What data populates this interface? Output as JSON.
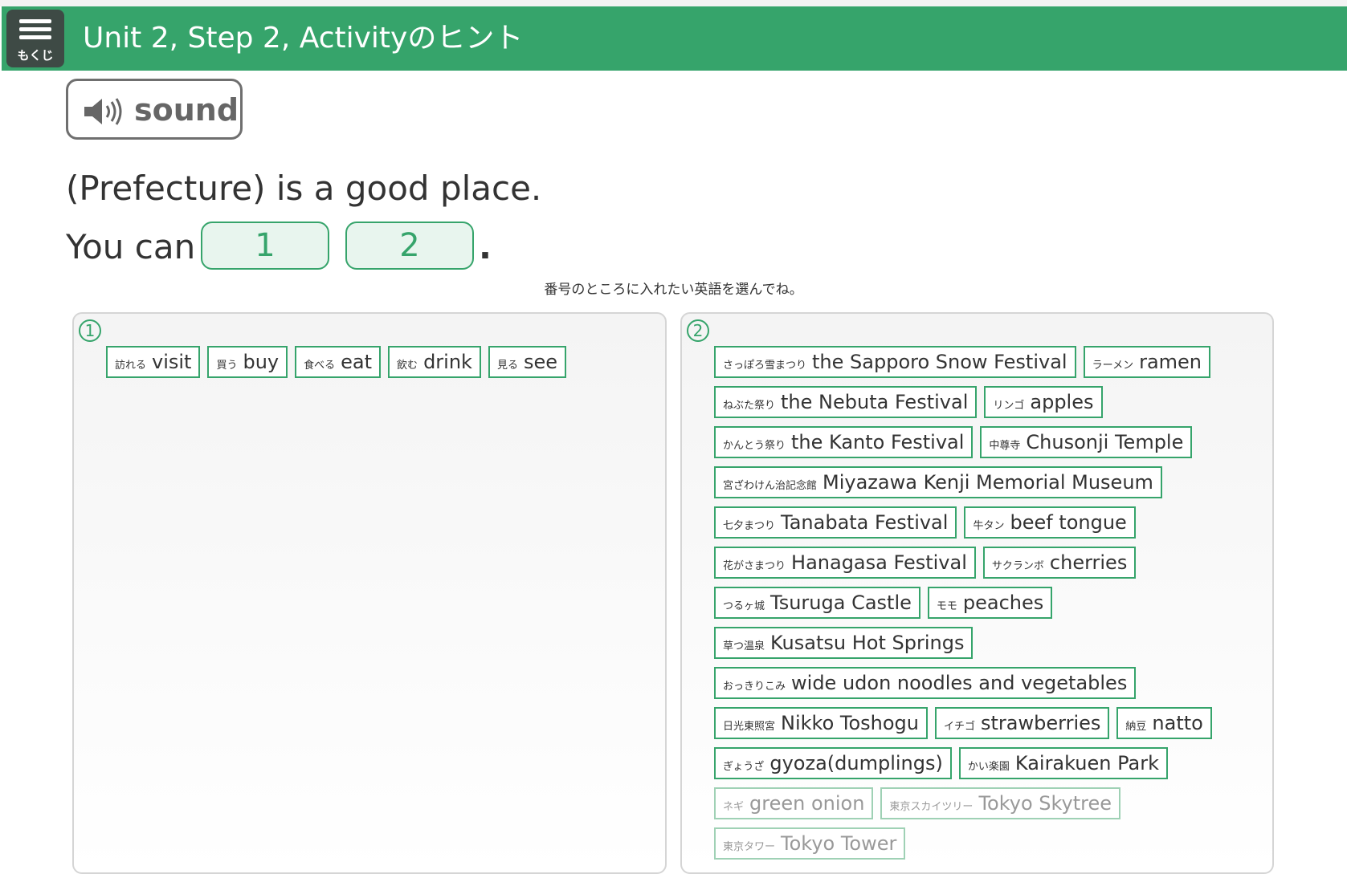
{
  "header": {
    "menu_label": "もくじ",
    "title": "Unit 2, Step 2, Activityのヒント"
  },
  "sound": {
    "label": "sound"
  },
  "sentence": {
    "line1": "(Prefecture) is a good place.",
    "line2_prefix": "You can",
    "blank1": "1",
    "blank2": "2",
    "period": "."
  },
  "instruction": "番号のところに入れたい英語を選んでね。",
  "panel1": {
    "number": "1",
    "chips": [
      {
        "jp": "訪れる",
        "en": "visit"
      },
      {
        "jp": "買う",
        "en": "buy"
      },
      {
        "jp": "食べる",
        "en": "eat"
      },
      {
        "jp": "飲む",
        "en": "drink"
      },
      {
        "jp": "見る",
        "en": "see"
      }
    ]
  },
  "panel2": {
    "number": "2",
    "rows": [
      [
        {
          "jp": "さっぽろ雪まつり",
          "en": "the Sapporo Snow Festival"
        },
        {
          "jp": "ラーメン",
          "en": "ramen"
        }
      ],
      [
        {
          "jp": "ねぶた祭り",
          "en": "the Nebuta Festival"
        },
        {
          "jp": "リンゴ",
          "en": "apples"
        }
      ],
      [
        {
          "jp": "かんとう祭り",
          "en": "the Kanto Festival"
        },
        {
          "jp": "中尊寺",
          "en": "Chusonji Temple"
        }
      ],
      [
        {
          "jp": "宮ざわけん治記念館",
          "en": "Miyazawa Kenji Memorial Museum"
        }
      ],
      [
        {
          "jp": "七夕まつり",
          "en": "Tanabata Festival"
        },
        {
          "jp": "牛タン",
          "en": "beef tongue"
        }
      ],
      [
        {
          "jp": "花がさまつり",
          "en": "Hanagasa Festival"
        },
        {
          "jp": "サクランボ",
          "en": "cherries"
        }
      ],
      [
        {
          "jp": "つるヶ城",
          "en": "Tsuruga Castle"
        },
        {
          "jp": "モモ",
          "en": "peaches"
        }
      ],
      [
        {
          "jp": "草つ温泉",
          "en": "Kusatsu Hot Springs"
        }
      ],
      [
        {
          "jp": "おっきりこみ",
          "en": "wide udon noodles and vegetables"
        }
      ],
      [
        {
          "jp": "日光東照宮",
          "en": "Nikko Toshogu"
        },
        {
          "jp": "イチゴ",
          "en": "strawberries"
        },
        {
          "jp": "納豆",
          "en": "natto"
        }
      ],
      [
        {
          "jp": "ぎょうざ",
          "en": "gyoza(dumplings)"
        },
        {
          "jp": "かい楽園",
          "en": "Kairakuen Park"
        }
      ],
      [
        {
          "jp": "ネギ",
          "en": "green onion",
          "faded": true
        },
        {
          "jp": "東京スカイツリー",
          "en": "Tokyo Skytree",
          "faded": true
        }
      ],
      [
        {
          "jp": "東京タワー",
          "en": "Tokyo Tower",
          "faded": true
        }
      ]
    ]
  },
  "colors": {
    "header_bg": "#36a46b",
    "menu_bg": "#3e4a45",
    "chip_border": "#36a46b",
    "blank_bg": "#e8f5ee"
  }
}
